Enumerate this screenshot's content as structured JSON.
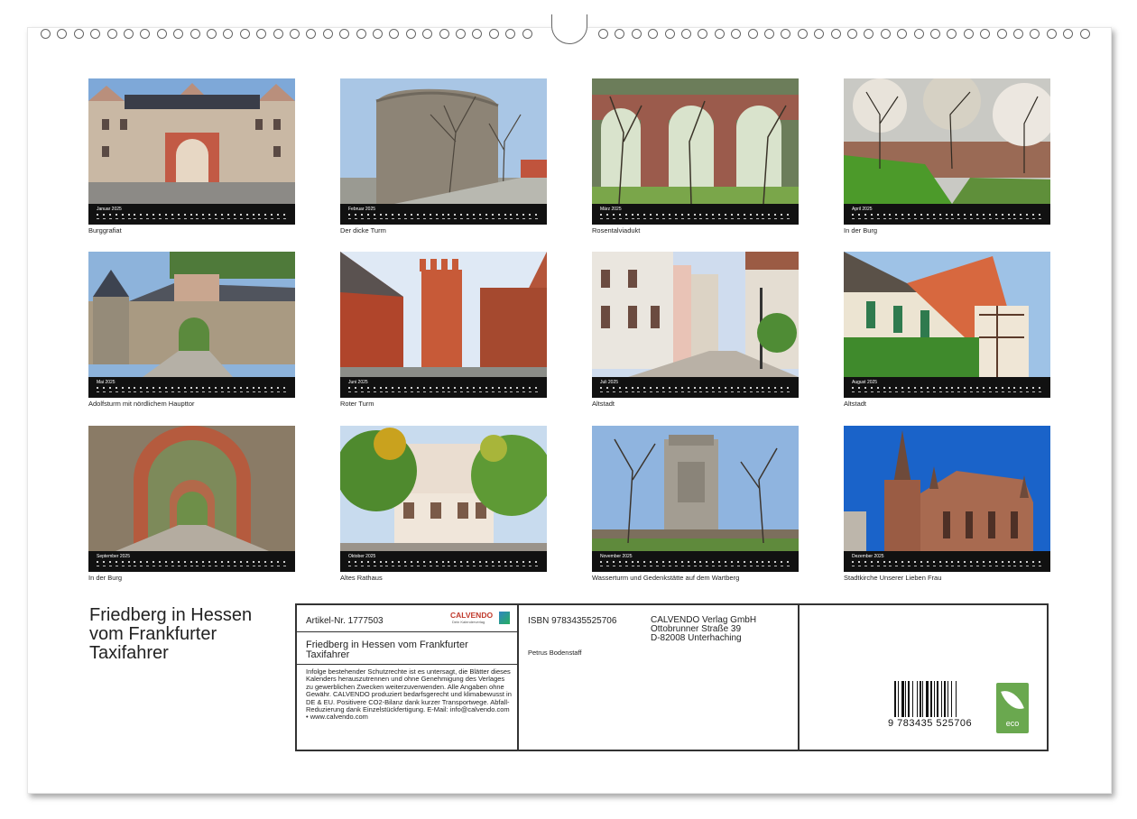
{
  "months": [
    {
      "name": "Januar 2025",
      "caption": "Burggrafiat"
    },
    {
      "name": "Februar 2025",
      "caption": "Der dicke Turm"
    },
    {
      "name": "März 2025",
      "caption": "Rosentalviadukt"
    },
    {
      "name": "April 2025",
      "caption": "In der Burg"
    },
    {
      "name": "Mai 2025",
      "caption": "Adolfsturm mit nördlichem Haupttor"
    },
    {
      "name": "Juni 2025",
      "caption": "Roter Turm"
    },
    {
      "name": "Juli 2025",
      "caption": "Altstadt"
    },
    {
      "name": "August 2025",
      "caption": "Altstadt"
    },
    {
      "name": "September 2025",
      "caption": "In der Burg"
    },
    {
      "name": "Oktober 2025",
      "caption": "Altes Rathaus"
    },
    {
      "name": "November 2025",
      "caption": "Wasserturm und Gedenkstätte auf dem Wartberg"
    },
    {
      "name": "Dezember 2025",
      "caption": "Stadtkirche Unserer Lieben Frau"
    }
  ],
  "title": "Friedberg in Hessen vom Frankfurter Taxifahrer",
  "info": {
    "article": "Artikel-Nr. 1777503",
    "logo_text": "CALVENDO",
    "logo_sub": "Dein Kalenderverlag",
    "subtitle": "Friedberg in Hessen vom Frankfurter Taxifahrer",
    "legal": "Infolge bestehender Schutzrechte ist es untersagt, die Blätter dieses Kalenders herauszutrennen und ohne Genehmigung des Verlages zu gewerblichen Zwecken weiterzuverwenden. Alle Angaben ohne Gewähr. CALVENDO produziert bedarfsgerecht und klimabewusst in DE & EU. Positivere CO2-Bilanz dank kurzer Transportwege. Abfall-Reduzierung dank Einzelstückfertigung. E-Mail: info@calvendo.com • www.calvendo.com",
    "isbn": "ISBN 9783435525706",
    "author": "Petrus Bodenstaff",
    "publisher_line1": "CALVENDO Verlag GmbH",
    "publisher_line2": "Ottobrunner Straße 39",
    "publisher_line3": "D-82008 Unterhaching",
    "barcode_number": "9 783435 525706",
    "eco_label": "eco"
  }
}
